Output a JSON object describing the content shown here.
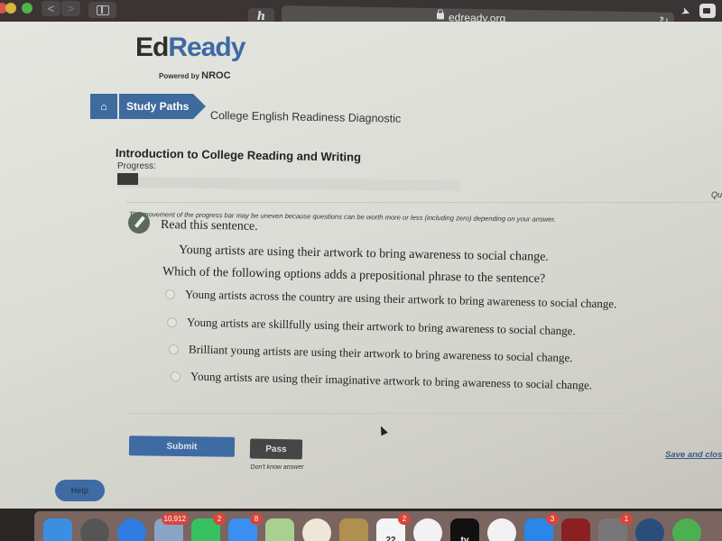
{
  "browser": {
    "url": "edready.org",
    "icons": [
      "back-icon",
      "forward-icon",
      "sidebar-icon",
      "extension-icon",
      "lock-icon",
      "reload-icon",
      "location-icon",
      "camera-icon"
    ],
    "glyphs": {
      "back": "<",
      "forward": ">",
      "extension": "ℎ",
      "reload": "↻",
      "location": "➤"
    }
  },
  "header": {
    "logo_ed": "Ed",
    "logo_ready": "Ready",
    "powered_by": "Powered by ",
    "nroc": "NROC"
  },
  "breadcrumb": {
    "home_icon": "⌂",
    "items": [
      "Study Paths",
      "College English Readiness Diagnostic"
    ]
  },
  "assessment": {
    "title": "Introduction to College Reading and Writing",
    "progress_label": "Progress:",
    "progress_percent": 6,
    "progress_note": "The movement of the progress bar may be uneven because questions can be worth more or less (including zero) depending on your answer.",
    "side_label": "Qu"
  },
  "question": {
    "intro": "Read this sentence.",
    "sentence": "Young artists are using their artwork to bring awareness to social change.",
    "prompt": "Which of the following options adds a prepositional phrase to the sentence?",
    "options": [
      "Young artists across the country are using their artwork to bring awareness to social change.",
      "Young artists are skillfully using their artwork to bring awareness to social change.",
      "Brilliant young artists are using their artwork to bring awareness to social change.",
      "Young artists are using their imaginative artwork to bring awareness to social change."
    ]
  },
  "actions": {
    "submit": "Submit",
    "pass": "Pass",
    "pass_note": "Don't know answer",
    "save_close": "Save and close",
    "help": "Help"
  },
  "dock": {
    "apps": [
      {
        "name": "finder",
        "color": "#3b8fe0",
        "badge": ""
      },
      {
        "name": "launchpad",
        "color": "#555",
        "badge": ""
      },
      {
        "name": "safari",
        "color": "#2f7de0",
        "badge": ""
      },
      {
        "name": "mail-preview",
        "color": "#8aa4c8",
        "badge": "10,912"
      },
      {
        "name": "facetime",
        "color": "#38c160",
        "badge": "2"
      },
      {
        "name": "messages",
        "color": "#3b8ff0",
        "badge": "8"
      },
      {
        "name": "maps",
        "color": "#a9d08e",
        "badge": ""
      },
      {
        "name": "photos",
        "color": "#f0e6d8",
        "badge": ""
      },
      {
        "name": "notes",
        "color": "#b09050",
        "badge": ""
      },
      {
        "name": "calendar",
        "color": "#f4f4f4",
        "badge": "2",
        "label": "22"
      },
      {
        "name": "music",
        "color": "#f2f2f2",
        "badge": ""
      },
      {
        "name": "tv",
        "color": "#111",
        "badge": "",
        "label": "tv"
      },
      {
        "name": "news",
        "color": "#f2f2f2",
        "badge": ""
      },
      {
        "name": "app-store",
        "color": "#2a86e8",
        "badge": "3"
      },
      {
        "name": "photo-booth",
        "color": "#8c2020",
        "badge": ""
      },
      {
        "name": "system-preferences",
        "color": "#777",
        "badge": "1"
      },
      {
        "name": "quicktime",
        "color": "#2a4d7a",
        "badge": ""
      },
      {
        "name": "find-my",
        "color": "#4caf50",
        "badge": ""
      }
    ]
  }
}
